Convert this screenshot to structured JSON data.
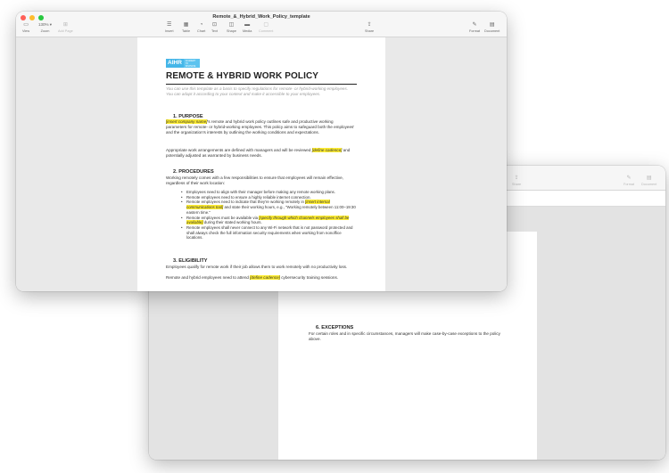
{
  "colors": {
    "close": "#ff5f57",
    "minimize": "#febc2e",
    "zoom": "#28c840",
    "logo_blue": "#45b6e8",
    "highlight": "#ffee33"
  },
  "front_window": {
    "title": "Remote_&_Hybrid_Work_Policy_template",
    "toolbar": {
      "view": {
        "label": "View",
        "icon": "sidebar-icon"
      },
      "zoom": {
        "label": "Zoom",
        "value": "130% ▾"
      },
      "add_page": {
        "label": "Add Page",
        "icon": "add-page-icon"
      },
      "insert": {
        "label": "Insert",
        "icon": "list-icon"
      },
      "table": {
        "label": "Table",
        "icon": "table-icon"
      },
      "chart": {
        "label": "Chart",
        "icon": "chart-icon"
      },
      "text": {
        "label": "Text",
        "icon": "textbox-icon"
      },
      "shape": {
        "label": "Shape",
        "icon": "shape-icon"
      },
      "media": {
        "label": "Media",
        "icon": "media-icon"
      },
      "comment": {
        "label": "Comment",
        "icon": "comment-icon"
      },
      "share": {
        "label": "Share",
        "icon": "share-icon"
      },
      "format": {
        "label": "Format",
        "icon": "paintbrush-icon"
      },
      "document": {
        "label": "Document",
        "icon": "document-icon"
      }
    },
    "doc": {
      "logo_text": "AIHR",
      "logo_tag": "ACADEMY TO INNOVATE HR",
      "title": "REMOTE & HYBRID WORK POLICY",
      "intro": "You can use this template as a basis to specify regulations for remote- or hybrid-working employees. You can adapt it according to your context and make it accessible to your employees.",
      "s1_heading": "1.  PURPOSE",
      "s1_p1_hl": "[insert company name]",
      "s1_p1_rest": "'s remote and hybrid work policy outlines safe and productive working parameters for remote- or hybrid-working employees. This policy aims to safeguard both the employees' and the organization's interests by outlining the working conditions and expectations.",
      "s1_p2_a": "Appropriate work arrangements are defined with managers and will be reviewed ",
      "s1_p2_hl": "[define cadence]",
      "s1_p2_b": " and potentially adjusted as warranted by business needs.",
      "s2_heading": "2.  PROCEDURES",
      "s2_intro": "Working remotely comes with a few responsibilities to ensure that employees will remain effective, regardless of their work location:",
      "bullets": {
        "b1": "Employees need to align with their manager before making any remote working plans.",
        "b2": "Remote employees need to ensure a highly reliable internet connection.",
        "b3_a": "Remote employees need to indicate that they're working remotely in ",
        "b3_hl": "[insert internal communications tool]",
        "b3_b": " and state their working hours, e.g., \"Working remotely between 11:00–19:30 eastern time.\"",
        "b4_a": "Remote employees must be available via ",
        "b4_hl": "[specify through which channels employees shall be available]",
        "b4_b": " during their stated working hours.",
        "b5": "Remote employees shall never connect to any Wi-Fi network that is not password protected and shall always check the full information security requirements when working from nonoffice locations."
      },
      "s3_heading": "3.  ELIGIBILITY",
      "s3_p1": "Employees qualify for remote work if their job allows them to work remotely with no productivity loss.",
      "s3_p2_a": "Remote and hybrid employees need to attend ",
      "s3_p2_hl": "[define cadence]",
      "s3_p2_b": " cybersecurity training sessions."
    }
  },
  "back_window": {
    "toolbar": {
      "share": {
        "label": "Share",
        "icon": "share-icon"
      },
      "format": {
        "label": "Format",
        "icon": "paintbrush-icon"
      },
      "document": {
        "label": "Document",
        "icon": "document-icon"
      }
    },
    "doc": {
      "s6_heading": "6.  EXCEPTIONS",
      "s6_p": "For certain roles and in specific circumstances, managers will make case-by-case exceptions to the policy above."
    }
  }
}
